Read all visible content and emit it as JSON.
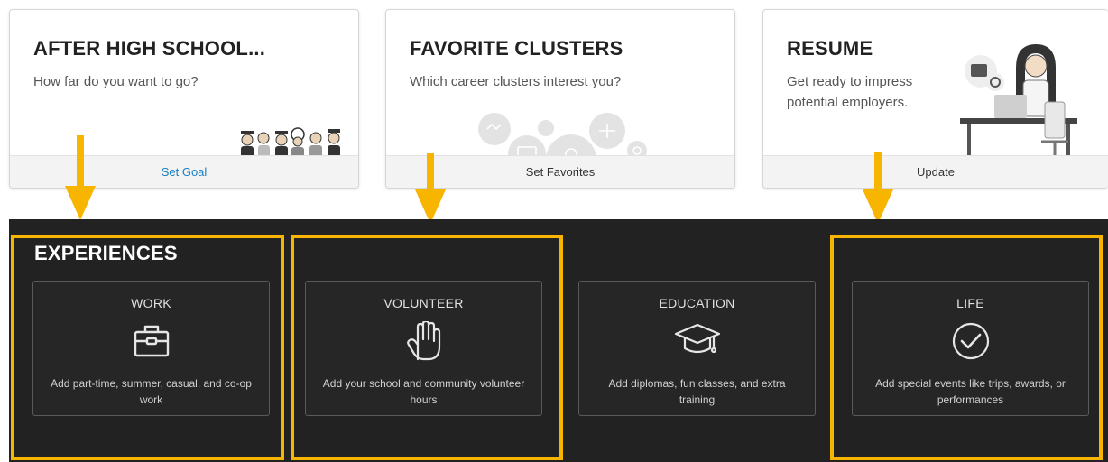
{
  "cards": [
    {
      "title": "AFTER HIGH SCHOOL...",
      "subtitle": "How far do you want to go?",
      "action": "Set Goal"
    },
    {
      "title": "FAVORITE CLUSTERS",
      "subtitle": "Which career clusters interest you?",
      "action": "Set Favorites"
    },
    {
      "title": "RESUME",
      "subtitle": "Get ready to impress potential employers.",
      "action": "Update"
    }
  ],
  "experiences": {
    "title": "EXPERIENCES",
    "items": [
      {
        "title": "WORK",
        "icon": "briefcase-icon",
        "description": "Add part-time, summer, casual, and co-op work"
      },
      {
        "title": "VOLUNTEER",
        "icon": "raised-hand-icon",
        "description": "Add your school and community volunteer hours"
      },
      {
        "title": "EDUCATION",
        "icon": "graduation-cap-icon",
        "description": "Add diplomas, fun classes, and extra training"
      },
      {
        "title": "LIFE",
        "icon": "check-circle-icon",
        "description": "Add special events like trips, awards, or performances"
      }
    ]
  },
  "colors": {
    "highlight": "#f7b500",
    "band": "#222222",
    "link": "#1a7ec2"
  }
}
